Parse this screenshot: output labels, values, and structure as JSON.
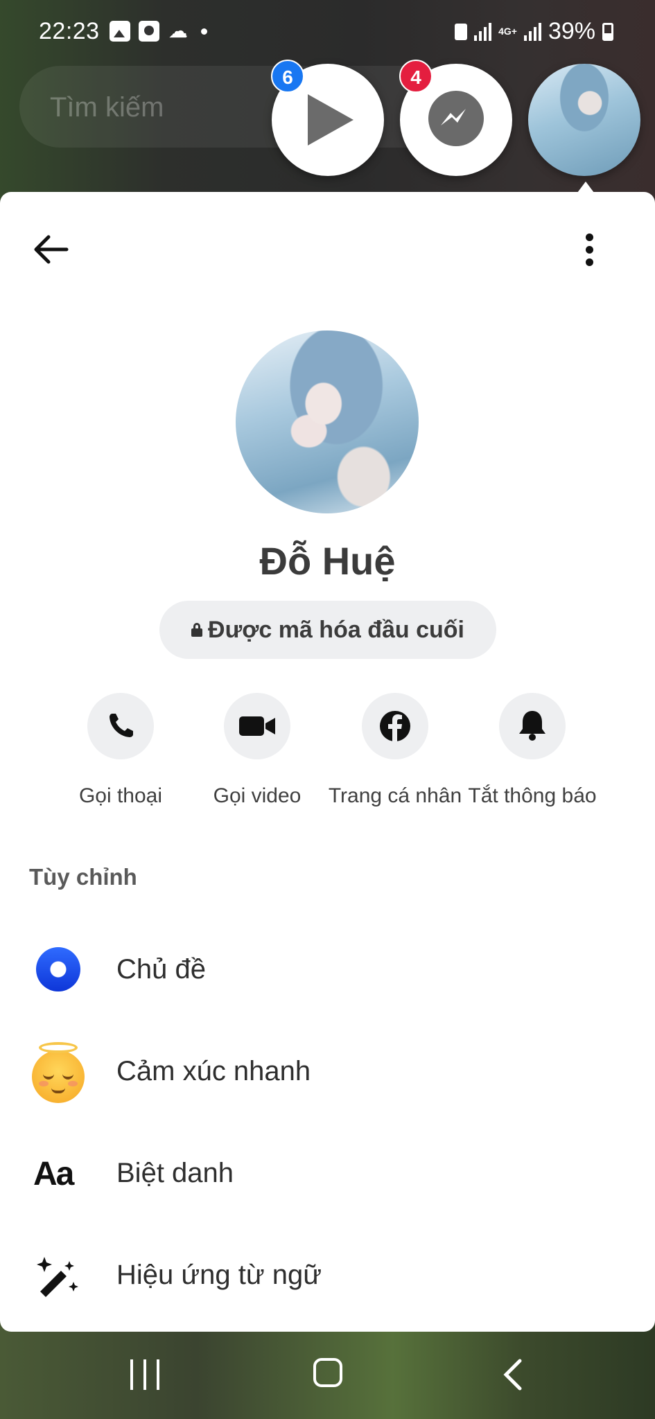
{
  "status_bar": {
    "time": "22:23",
    "network": "4G+",
    "battery": "39%"
  },
  "search": {
    "placeholder": "Tìm kiếm"
  },
  "chat_heads": [
    {
      "name": "video-chathead",
      "badge": "6"
    },
    {
      "name": "messenger-chathead",
      "badge": "4"
    },
    {
      "name": "contact-chathead"
    }
  ],
  "profile": {
    "name": "Đỗ Huệ",
    "encryption_label": "Được mã hóa đầu cuối"
  },
  "actions": [
    {
      "label": "Gọi thoại",
      "icon": "phone-icon"
    },
    {
      "label": "Gọi video",
      "icon": "video-camera-icon"
    },
    {
      "label": "Trang cá nhân",
      "icon": "facebook-icon"
    },
    {
      "label": "Tắt thông báo",
      "icon": "bell-icon"
    }
  ],
  "customize": {
    "title": "Tùy chỉnh",
    "items": [
      {
        "label": "Chủ đề",
        "icon": "theme-icon"
      },
      {
        "label": "Cảm xúc nhanh",
        "icon": "emoji-icon"
      },
      {
        "label": "Biệt danh",
        "icon": "nickname-icon",
        "icon_text": "Aa"
      },
      {
        "label": "Hiệu ứng từ ngữ",
        "icon": "word-effects-icon"
      }
    ]
  },
  "colors": {
    "accent": "#1877f2",
    "badge_red": "#e41e3f",
    "theme_blue": "#1f4fe8",
    "sheet_bg": "#ffffff",
    "pill_bg": "#eeeff1"
  }
}
